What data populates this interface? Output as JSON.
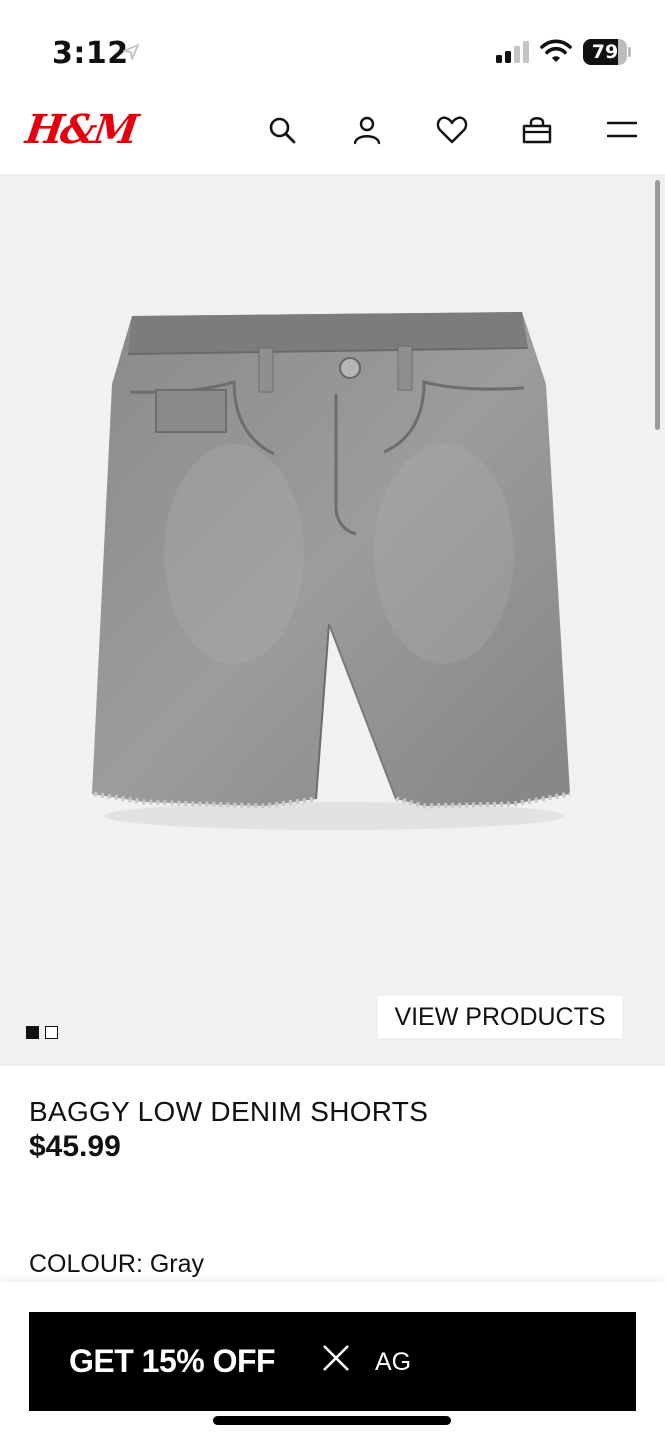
{
  "status_bar": {
    "time": "3:12",
    "battery_level": "79",
    "battery_fraction": 0.79
  },
  "header": {
    "logo": "H&M",
    "logo_color": "#e50010",
    "icons": [
      "search-icon",
      "account-icon",
      "favorites-icon",
      "shopping-bag-icon",
      "menu-icon"
    ]
  },
  "gallery": {
    "image": "gray denim shorts product photo",
    "slide_count": 2,
    "active_slide": 1,
    "view_products_label": "VIEW PRODUCTS"
  },
  "product": {
    "name": "BAGGY LOW DENIM SHORTS",
    "price": "$45.99",
    "colour_label": "COLOUR:",
    "colour_value": "Gray"
  },
  "promo_banner": {
    "text": "GET 15% OFF",
    "tail": "AG"
  }
}
